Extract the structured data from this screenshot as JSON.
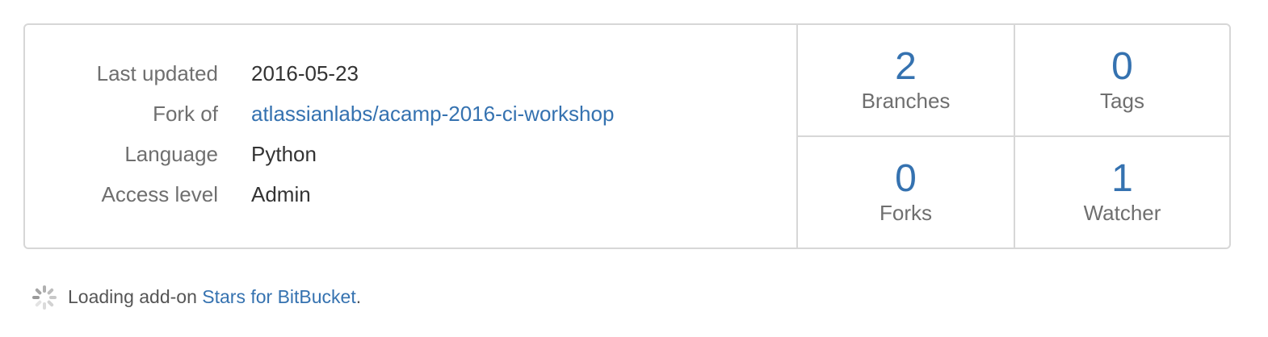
{
  "details": {
    "last_updated_label": "Last updated",
    "last_updated_value": "2016-05-23",
    "fork_of_label": "Fork of",
    "fork_of_value": "atlassianlabs/acamp-2016-ci-workshop",
    "language_label": "Language",
    "language_value": "Python",
    "access_level_label": "Access level",
    "access_level_value": "Admin"
  },
  "stats": {
    "branches": {
      "count": "2",
      "label": "Branches"
    },
    "tags": {
      "count": "0",
      "label": "Tags"
    },
    "forks": {
      "count": "0",
      "label": "Forks"
    },
    "watchers": {
      "count": "1",
      "label": "Watcher"
    }
  },
  "loading": {
    "prefix": "Loading add-on ",
    "addon_name": "Stars for BitBucket",
    "suffix": "."
  },
  "colors": {
    "link": "#3572b0",
    "label": "#6f6f6f",
    "border": "#d7d7d7"
  },
  "icons": {
    "spinner": "loading-spinner-icon"
  }
}
